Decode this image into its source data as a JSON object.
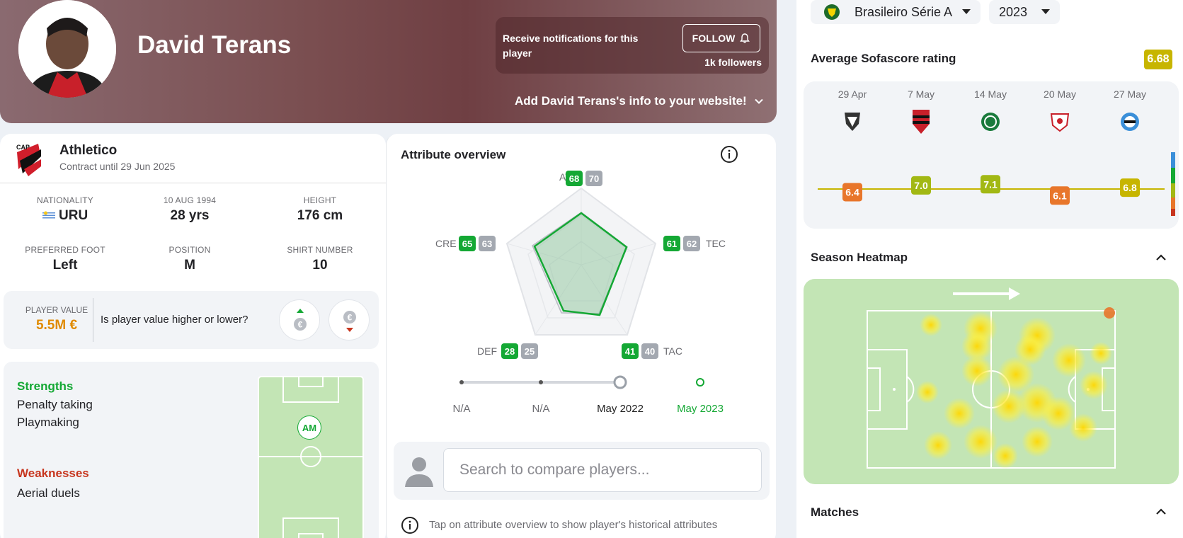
{
  "header": {
    "player_name": "David Terans",
    "notification_text": "Receive notifications for this player",
    "follow_label": "FOLLOW",
    "followers": "1k followers",
    "add_info": "Add David Terans's info to your website!"
  },
  "team": {
    "name": "Athletico",
    "contract": "Contract until 29 Jun 2025"
  },
  "details": {
    "nationality_label": "NATIONALITY",
    "nationality": "URU",
    "dob_label": "10 AUG 1994",
    "age": "28 yrs",
    "height_label": "HEIGHT",
    "height": "176 cm",
    "foot_label": "PREFERRED FOOT",
    "foot": "Left",
    "position_label": "POSITION",
    "position": "M",
    "shirt_label": "SHIRT NUMBER",
    "shirt": "10"
  },
  "value": {
    "label": "PLAYER VALUE",
    "amount": "5.5M €",
    "question": "Is player value higher or lower?"
  },
  "strengths": {
    "title": "Strengths",
    "items": [
      "Penalty taking",
      "Playmaking"
    ]
  },
  "weaknesses": {
    "title": "Weaknesses",
    "items": [
      "Aerial duels"
    ]
  },
  "pitch_position": "AM",
  "attributes": {
    "title": "Attribute overview",
    "items": [
      {
        "key": "ATT",
        "current": "68",
        "avg": "70"
      },
      {
        "key": "TEC",
        "current": "61",
        "avg": "62"
      },
      {
        "key": "TAC",
        "current": "41",
        "avg": "40"
      },
      {
        "key": "DEF",
        "current": "28",
        "avg": "25"
      },
      {
        "key": "CRE",
        "current": "65",
        "avg": "63"
      }
    ],
    "timeline": [
      "N/A",
      "N/A",
      "May 2022",
      "May 2023"
    ],
    "search_placeholder": "Search to compare players...",
    "hint": "Tap on attribute overview to show player's historical attributes"
  },
  "league": {
    "name": "Brasileiro Série A",
    "season": "2023"
  },
  "rating": {
    "title": "Average Sofascore rating",
    "average": "6.68",
    "matches": [
      {
        "date": "29 Apr",
        "rating": "6.4",
        "color": "#e8762b"
      },
      {
        "date": "7 May",
        "rating": "7.0",
        "color": "#a2b814"
      },
      {
        "date": "14 May",
        "rating": "7.1",
        "color": "#a2b814"
      },
      {
        "date": "20 May",
        "rating": "6.1",
        "color": "#e8762b"
      },
      {
        "date": "27 May",
        "rating": "6.8",
        "color": "#c7b500"
      }
    ]
  },
  "heatmap": {
    "title": "Season Heatmap"
  },
  "matches": {
    "title": "Matches"
  },
  "colors": {
    "green": "#14a834",
    "gray": "#a3a8b0",
    "orange": "#e08a00",
    "red": "#c7361f"
  }
}
